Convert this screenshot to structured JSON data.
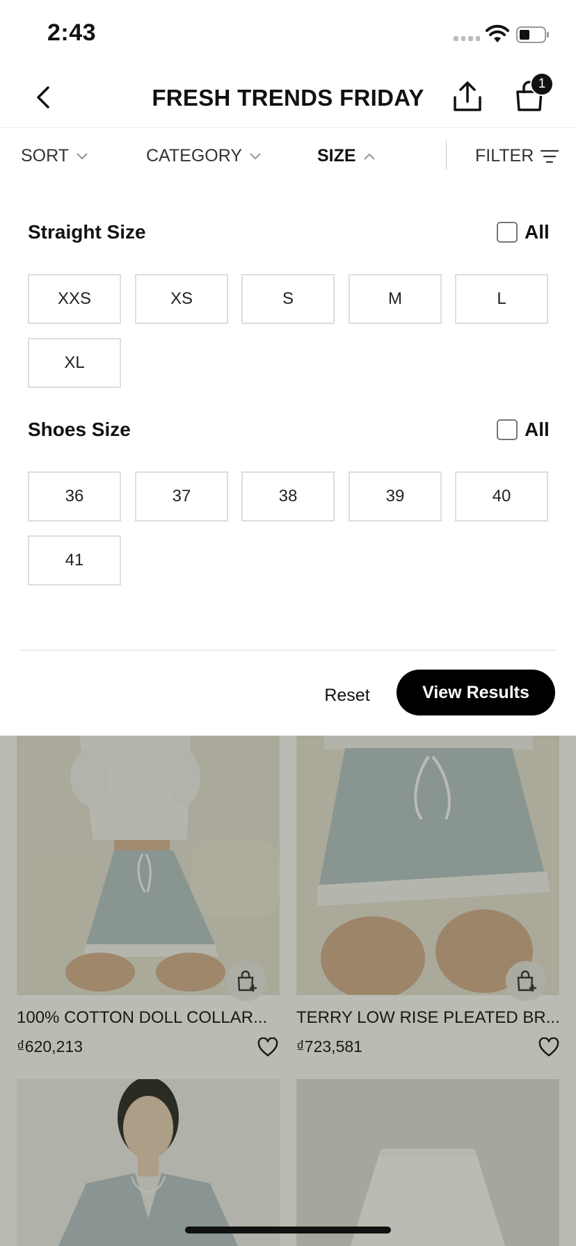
{
  "status": {
    "time": "2:43"
  },
  "header": {
    "title": "FRESH TRENDS FRIDAY",
    "cart_count": "1"
  },
  "sort_bar": {
    "sort": "SORT",
    "category": "CATEGORY",
    "size": "SIZE",
    "filter": "FILTER"
  },
  "size_panel": {
    "straight": {
      "title": "Straight Size",
      "all_label": "All",
      "options": [
        "XXS",
        "XS",
        "S",
        "M",
        "L",
        "XL"
      ]
    },
    "shoes": {
      "title": "Shoes Size",
      "all_label": "All",
      "options": [
        "36",
        "37",
        "38",
        "39",
        "40",
        "41"
      ]
    },
    "reset_label": "Reset",
    "view_label": "View Results"
  },
  "products": [
    {
      "name": "100% COTTON DOLL COLLAR...",
      "price": "₫620,213"
    },
    {
      "name": "TERRY LOW RISE PLEATED BR...",
      "price": "₫723,581"
    }
  ],
  "colors": {
    "accent": "#000000",
    "overlay": "#283014"
  }
}
